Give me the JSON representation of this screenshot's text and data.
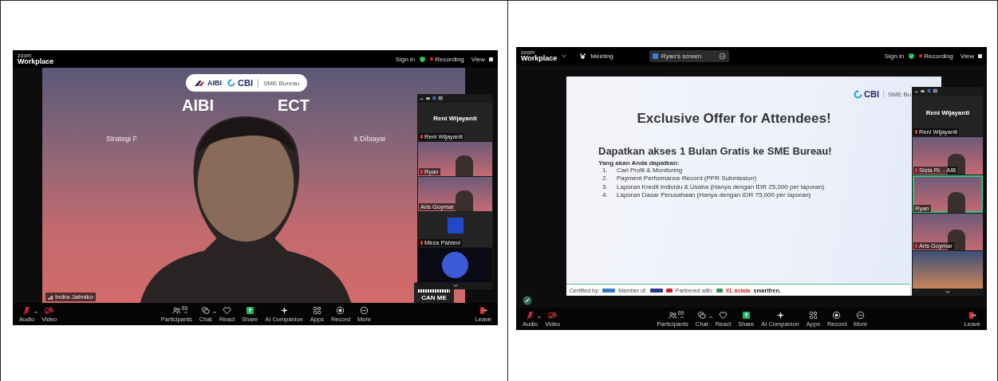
{
  "panels": [
    {
      "window": {
        "brand_small": "zoom",
        "brand": "Workplace",
        "menu_caret": false,
        "sign_in": "Sign in",
        "recording": "Recording",
        "view": "View"
      },
      "stage": {
        "kind": "camera",
        "logos": [
          "AIBI",
          "CBI",
          "SME Bureau"
        ],
        "title": [
          "AIBI",
          "ECT"
        ],
        "subtitle": [
          "Strategi F",
          "k Dibiayai"
        ],
        "name_tag": "Indra Jatmiko",
        "qr_caption": "CAN ME"
      },
      "gallery": {
        "tiles": [
          {
            "kind": "name",
            "caption": "Reni Wijayanti",
            "label": "Reni Wijayanti",
            "muted": true
          },
          {
            "kind": "video",
            "label": "Ryan",
            "muted": true,
            "speaking": false
          },
          {
            "kind": "video",
            "label": "Aris Goymar",
            "muted": false,
            "speaking": false
          },
          {
            "kind": "avatar",
            "label": "Mirza Pahlevi",
            "muted": true
          },
          {
            "kind": "image"
          }
        ]
      },
      "toolbar": {
        "left": [
          {
            "kind": "audio",
            "label": "Audio",
            "off": true,
            "caret": true
          },
          {
            "kind": "video",
            "label": "Video",
            "off": true,
            "caret": false
          }
        ],
        "center": [
          {
            "kind": "participants",
            "label": "Participants",
            "badge": "69",
            "caret": true
          },
          {
            "kind": "chat",
            "label": "Chat",
            "caret": true
          },
          {
            "kind": "react",
            "label": "React",
            "caret": false
          },
          {
            "kind": "share",
            "label": "Share",
            "caret": false
          },
          {
            "kind": "ai",
            "label": "AI Companion",
            "caret": false
          },
          {
            "kind": "apps",
            "label": "Apps",
            "caret": false
          },
          {
            "kind": "record",
            "label": "Record",
            "caret": false
          },
          {
            "kind": "more",
            "label": "More",
            "caret": false
          }
        ],
        "right": [
          {
            "kind": "leave",
            "label": "Leave",
            "caret": false
          }
        ]
      }
    },
    {
      "window": {
        "brand_small": "zoom",
        "brand": "Workplace",
        "menu_caret": true,
        "meeting": "Meeting",
        "share_tab": "Ryan's screen",
        "sign_in": "Sign in",
        "recording": "Recording",
        "view": "View"
      },
      "stage": {
        "kind": "slide",
        "logo": "CBI",
        "logo_side": "SME Bu",
        "title": "Exclusive Offer for Attendees!",
        "heading": "Dapatkan akses 1 Bulan Gratis ke SME Bureau!",
        "intro": "Yang akan Anda dapatkan:",
        "items": [
          {
            "number": "1.",
            "text": "Cari Profil & Monitoring"
          },
          {
            "number": "2.",
            "text": "Payment Performance Record (PPR Submission)"
          },
          {
            "number": "3.",
            "text": "Laporan Kredit Individu & Usaha (Hanya dengan IDR 25,000 per laporan)"
          },
          {
            "number": "4.",
            "text": "Laporan Dasar Perusahaan (Hanya dengan IDR 75,000 per laporan)"
          }
        ],
        "footer": {
          "certified": "Certified by:",
          "member": "Member of:",
          "partnered": "Partnered with:",
          "partners": [
            "XL axiata",
            "smartfren."
          ]
        }
      },
      "gallery": {
        "tiles": [
          {
            "kind": "name",
            "caption": "Reni Wijayanti",
            "label": "Reni Wijayanti",
            "muted": true
          },
          {
            "kind": "video",
            "label": "Sista Ri. - AIB",
            "muted": true,
            "speaking": false
          },
          {
            "kind": "video",
            "label": "Ryan",
            "muted": false,
            "speaking": true
          },
          {
            "kind": "video",
            "label": "Aris Goymar",
            "muted": true,
            "speaking": false
          },
          {
            "kind": "image"
          }
        ]
      },
      "toolbar": {
        "left": [
          {
            "kind": "audio",
            "label": "Audio",
            "off": true,
            "caret": true
          },
          {
            "kind": "video",
            "label": "Video",
            "off": true,
            "caret": false
          }
        ],
        "center": [
          {
            "kind": "participants",
            "label": "Participants",
            "badge": "69",
            "caret": true
          },
          {
            "kind": "chat",
            "label": "Chat",
            "caret": true
          },
          {
            "kind": "react",
            "label": "React",
            "caret": false
          },
          {
            "kind": "share",
            "label": "Share",
            "caret": false
          },
          {
            "kind": "ai",
            "label": "AI Companion",
            "caret": false
          },
          {
            "kind": "apps",
            "label": "Apps",
            "caret": false
          },
          {
            "kind": "record",
            "label": "Record",
            "caret": false
          },
          {
            "kind": "more",
            "label": "More",
            "caret": false
          }
        ],
        "right": [
          {
            "kind": "leave",
            "label": "Leave",
            "caret": false
          }
        ]
      }
    }
  ]
}
